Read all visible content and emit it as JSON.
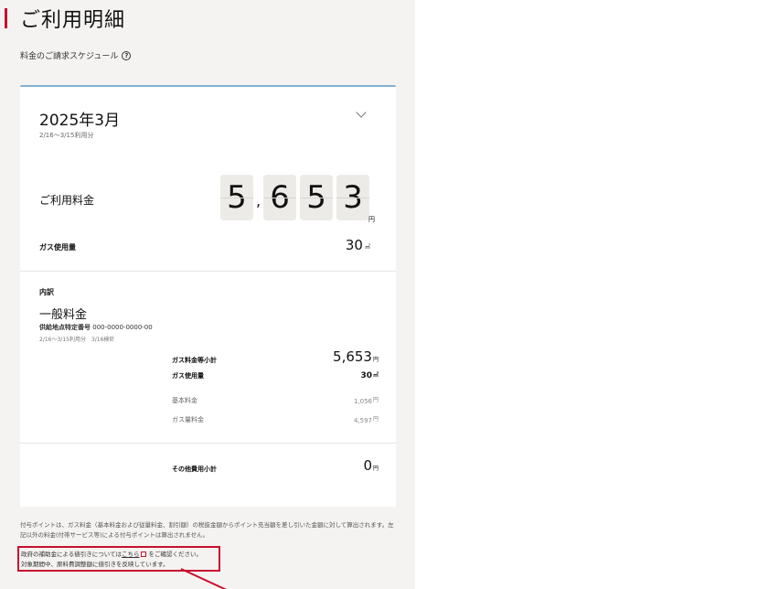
{
  "page": {
    "title": "ご利用明細",
    "schedule_link": "料金のご請求スケジュール",
    "help_icon": "?"
  },
  "bill": {
    "month": "2025年3月",
    "period": "2/16〜3/15利用分",
    "usage_label": "ご利用料金",
    "amount_digits": [
      "5",
      "6",
      "5",
      "3"
    ],
    "amount_separator": ",",
    "amount_unit": "円",
    "gas_label": "ガス使用量",
    "gas_value": "30",
    "gas_unit": "㎥"
  },
  "breakdown": {
    "heading": "内訳",
    "plan_name": "一般料金",
    "supply_label": "供給地点特定番号",
    "supply_number": "000-0000-0000-00",
    "meter_info": "2/16〜3/15利用分　3/16検針",
    "rows": [
      {
        "label": "ガス料金等小計",
        "value": "5,653",
        "unit": "円"
      },
      {
        "label": "ガス使用量",
        "value": "30",
        "unit": "㎥"
      },
      {
        "label": "基本料金",
        "value": "1,056",
        "unit": "円"
      },
      {
        "label": "ガス量料金",
        "value": "4,597",
        "unit": "円"
      }
    ],
    "other": {
      "label": "その他費用小計",
      "value": "0",
      "unit": "円"
    }
  },
  "notes": {
    "points": "付与ポイントは、ガス料金（基本料金および従量料金、割引額）の税抜金額からポイント充当額を差し引いた金額に対して算出されます。左記以外の料金(付帯サービス等)による付与ポイントは算出されません。",
    "subsidy_before": "政府の補助金による値引きについては",
    "subsidy_link": "こちら",
    "subsidy_after": "をご確認ください。",
    "subsidy_line2": "対象期間中、原料費調整額に値引きを反映しています。"
  },
  "colors": {
    "accent": "#c8102e",
    "card_border": "#7fb1cf",
    "panel_bg": "#f4f3f1"
  }
}
